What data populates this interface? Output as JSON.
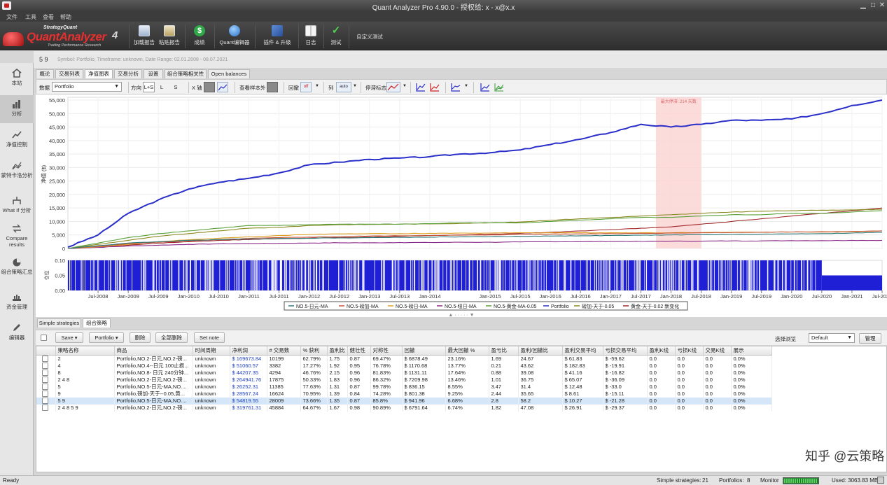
{
  "app": {
    "title": "Quant Analyzer Pro 4.90.0 - 授权给: x - x@x.x",
    "menu": [
      "文件",
      "工具",
      "查看",
      "帮助"
    ]
  },
  "logo": {
    "small_text": "StrategyQuant",
    "product_name": "QuantAnalyzer",
    "version": "4",
    "tagline": "Trading Performance Research"
  },
  "toolbar": {
    "buttons": [
      {
        "label": "加载报告",
        "icon": "load-report-icon"
      },
      {
        "label": "粘贴报告",
        "icon": "paste-report-icon"
      },
      {
        "label": "成绩",
        "icon": "dollar-icon"
      },
      {
        "label": "Quant编辑器",
        "icon": "editor-icon"
      },
      {
        "label": "插件 & 升级",
        "icon": "plugin-icon"
      },
      {
        "label": "日志",
        "icon": "log-icon"
      },
      {
        "label": "测试",
        "icon": "checkmark-icon"
      },
      {
        "label": "自定义测试",
        "icon": ""
      }
    ]
  },
  "sidebar": {
    "items": [
      {
        "label": "本站",
        "icon": "home-icon"
      },
      {
        "label": "分析",
        "icon": "analysis-icon"
      },
      {
        "label": "净值控制",
        "icon": "equity-control-icon"
      },
      {
        "label": "蒙特卡洛分析",
        "icon": "monte-carlo-icon"
      },
      {
        "label": "What If 分析",
        "icon": "whatif-icon"
      },
      {
        "label": "Compare results",
        "icon": "compare-icon"
      },
      {
        "label": "组合策略汇总",
        "icon": "pie-chart-icon"
      },
      {
        "label": "资金管理",
        "icon": "money-management-icon"
      },
      {
        "label": "编辑器",
        "icon": "pencil-icon"
      }
    ]
  },
  "strategy_header": {
    "name": "5 9",
    "info": "Symbol: Portfolio, Timeframe: unknown, Date Range: 02.01.2008 - 08.07.2021"
  },
  "tabs": [
    "概论",
    "交易列表",
    "净值图表",
    "交易分析",
    "设置",
    "组合策略相关性",
    "Open balances"
  ],
  "chart_toolbar": {
    "data_label": "数据",
    "data_value": "Portfolio",
    "direction_label": "方向",
    "direction_options": [
      "L+S",
      "L",
      "S"
    ],
    "x_axis_label": "X 轴",
    "out_of_sample_label": "查看样本外",
    "drawdown_label": "回撤",
    "drawdown_value": "off",
    "column_label": "列",
    "column_value": "auto",
    "stagnation_label": "停滞标志"
  },
  "chart_data": {
    "type": "line",
    "ylabel": "净值 ($)",
    "ylim": [
      0,
      55000
    ],
    "y_ticks": [
      "0",
      "5,000",
      "10,000",
      "15,000",
      "20,000",
      "25,000",
      "30,000",
      "35,000",
      "40,000",
      "45,000",
      "50,000",
      "55,000"
    ],
    "x_ticks": [
      "Jul-2008",
      "Jan-2009",
      "Jul-2009",
      "Jan-2010",
      "Jul-2010",
      "Jan-2011",
      "Jul-2011",
      "Jan-2012",
      "Jul-2012",
      "Jan-2013",
      "Jul-2013",
      "Jan-2014",
      "Jan-2015",
      "Jul-2015",
      "Jan-2016",
      "Jul-2016",
      "Jan-2017",
      "Jul-2017",
      "Jan-2018",
      "Jul-2018",
      "Jan-2019",
      "Jul-2019",
      "Jan-2020",
      "Jul-2020",
      "Jan-2021",
      "Jul-2021"
    ],
    "stagnation_label": "最大停滞: 214 天数",
    "stagnation_range": [
      "Oct-2017",
      "Jul-2018"
    ],
    "x": [
      "Jan-2008",
      "Jul-2008",
      "Jan-2009",
      "Jul-2009",
      "Jan-2010",
      "Jul-2010",
      "Jan-2011",
      "Jul-2011",
      "Jan-2012",
      "Jul-2012",
      "Jan-2013",
      "Jul-2013",
      "Jan-2014",
      "Jul-2014",
      "Jan-2015",
      "Jul-2015",
      "Jan-2016",
      "Jul-2016",
      "Jan-2017",
      "Jul-2017",
      "Jan-2018",
      "Jul-2018",
      "Jan-2019",
      "Jul-2019",
      "Jan-2020",
      "Jul-2020",
      "Jan-2021",
      "Jul-2021"
    ],
    "series": [
      {
        "name": "Portfolio",
        "color": "#2a2fc9",
        "values": [
          500,
          5000,
          13000,
          18000,
          22000,
          24500,
          26000,
          28000,
          31000,
          32000,
          33000,
          33500,
          34000,
          35000,
          35500,
          36500,
          38500,
          40500,
          43000,
          46000,
          45000,
          46000,
          47500,
          47500,
          48000,
          50000,
          53000,
          55000
        ]
      },
      {
        "name": "NO.5-日元-MA",
        "color": "#2d7a7a",
        "values": [
          0,
          1000,
          2000,
          2500,
          3000,
          3300,
          3500,
          3700,
          3800,
          3900,
          4000,
          4100,
          4200,
          4300,
          4400,
          4500,
          4600,
          4700,
          4800,
          4900,
          5000,
          5100,
          5200,
          5300,
          5400,
          5500,
          5700,
          6000
        ]
      },
      {
        "name": "NO.5-磅加-MA",
        "color": "#c5563c",
        "values": [
          0,
          800,
          1800,
          2300,
          2700,
          3300,
          3700,
          4000,
          4200,
          4400,
          4600,
          4700,
          4800,
          4900,
          5000,
          5200,
          5300,
          5400,
          5500,
          5600,
          5700,
          5800,
          5900,
          6000,
          6100,
          6200,
          6300,
          6500
        ]
      },
      {
        "name": "NO.5-磅日-MA",
        "color": "#e0a020",
        "values": [
          0,
          600,
          1500,
          2500,
          3200,
          3800,
          4300,
          4800,
          5200,
          5400,
          5500,
          5500,
          5600,
          5700,
          5700,
          5800,
          5800,
          5800,
          5800,
          5800,
          5800,
          5900,
          6000,
          6000,
          6100,
          6100,
          6200,
          6500
        ]
      },
      {
        "name": "NO.5-纽日-MA",
        "color": "#8a2a8a",
        "values": [
          0,
          400,
          900,
          1200,
          1500,
          1700,
          1800,
          1900,
          2000,
          2100,
          2100,
          2200,
          2200,
          2300,
          2300,
          2400,
          2500,
          2500,
          2600,
          2600,
          2700,
          2700,
          2800,
          2800,
          2900,
          2900,
          3000,
          3000
        ]
      },
      {
        "name": "NO.5-黄金-MA-0.05",
        "color": "#5aa03a",
        "values": [
          0,
          2000,
          4000,
          5500,
          6500,
          7500,
          8500,
          8500,
          8800,
          9000,
          9000,
          9000,
          9200,
          9500,
          9500,
          9500,
          10000,
          10500,
          11000,
          11500,
          11500,
          12000,
          12500,
          12500,
          13000,
          13000,
          13500,
          14000
        ]
      },
      {
        "name": "磅加-天于-0.05",
        "color": "#8a8a22",
        "values": [
          0,
          1500,
          3000,
          4500,
          5500,
          6500,
          7500,
          7800,
          8500,
          8800,
          8900,
          9000,
          9100,
          9300,
          9500,
          9800,
          10500,
          11000,
          11500,
          12000,
          12500,
          13000,
          13500,
          13800,
          14000,
          14200,
          14300,
          14500
        ]
      },
      {
        "name": "黄金-天于-0.02 新变化",
        "color": "#a0282a",
        "values": [
          0,
          500,
          1200,
          2000,
          2500,
          3000,
          3300,
          3600,
          3800,
          4000,
          4200,
          4500,
          4800,
          5000,
          5300,
          5600,
          6000,
          6500,
          7000,
          7500,
          8000,
          9000,
          10000,
          11000,
          12000,
          13000,
          14000,
          15000
        ]
      }
    ],
    "positions_ylim": [
      0.0,
      0.1
    ],
    "positions_ylabel": "仓位",
    "positions_y_ticks": [
      "0.00",
      "0.05",
      "0.10"
    ]
  },
  "bottom": {
    "tabs": [
      "Simple strategies",
      "组合策略"
    ],
    "buttons": [
      "Save",
      "Portfolio",
      "删除",
      "全部删除",
      "Set note"
    ],
    "view_label": "选择浏览",
    "view_value": "Default",
    "manage_label": "管理",
    "columns": [
      "策略名称",
      "商品",
      "时间周期",
      "净利润",
      "# 交易数",
      "% 获利",
      "盈利比",
      "健壮性",
      "对称性",
      "回撤",
      "最大回撤 %",
      "盈亏比",
      "盈利/回撤比",
      "盈利交易平均",
      "亏损交易平均",
      "盈利K线",
      "亏损K线",
      "交易K线",
      "展示"
    ],
    "rows": [
      [
        "2",
        "Portfolio,NO.2-日元,NO.2-磅...",
        "unknown",
        "$ 169673.84",
        "10199",
        "62.79%",
        "1.75",
        "0.87",
        "69.47%",
        "$ 6878.49",
        "23.16%",
        "1.69",
        "24.67",
        "$ 61.83",
        "$ -59.62",
        "0.0",
        "0.0",
        "0.0",
        "0.0%"
      ],
      [
        "4",
        "Portfolio,NO.4--日元 100止损...",
        "unknown",
        "$ 51060.57",
        "3382",
        "17.27%",
        "1.92",
        "0.95",
        "76.78%",
        "$ 1170.68",
        "13.77%",
        "0.21",
        "43.62",
        "$ 182.83",
        "$ -19.91",
        "0.0",
        "0.0",
        "0.0",
        "0.0%"
      ],
      [
        "8",
        "Portfolio,NO.8- 日元 240分钟...",
        "unknown",
        "$ 44207.35",
        "4294",
        "46.76%",
        "2.15",
        "0.96",
        "81.83%",
        "$ 1131.11",
        "17.64%",
        "0.88",
        "39.08",
        "$ 41.16",
        "$ -16.82",
        "0.0",
        "0.0",
        "0.0",
        "0.0%"
      ],
      [
        "2 4 8",
        "Portfolio,NO.2-日元,NO.2-磅...",
        "unknown",
        "$ 264941.76",
        "17875",
        "50.33%",
        "1.83",
        "0.96",
        "86.32%",
        "$ 7209.98",
        "13.46%",
        "1.01",
        "36.75",
        "$ 65.07",
        "$ -36.09",
        "0.0",
        "0.0",
        "0.0",
        "0.0%"
      ],
      [
        "5",
        "Portfolio,NO.5-日元-MA,NO....",
        "unknown",
        "$ 26252.31",
        "11385",
        "77.63%",
        "1.31",
        "0.87",
        "99.78%",
        "$ 836.15",
        "8.55%",
        "3.47",
        "31.4",
        "$ 12.48",
        "$ -33.0",
        "0.0",
        "0.0",
        "0.0",
        "0.0%"
      ],
      [
        "9",
        "Portfolio,磅加-天于--0.05,黄...",
        "unknown",
        "$ 28567.24",
        "16624",
        "70.95%",
        "1.39",
        "0.84",
        "74.28%",
        "$ 801.38",
        "9.25%",
        "2.44",
        "35.65",
        "$ 8.61",
        "$ -15.11",
        "0.0",
        "0.0",
        "0.0",
        "0.0%"
      ],
      [
        "5 9",
        "Portfolio,NO.5-日元-MA,NO....",
        "unknown",
        "$ 54819.55",
        "28009",
        "73.66%",
        "1.35",
        "0.87",
        "85.8%",
        "$ 941.96",
        "6.68%",
        "2.8",
        "58.2",
        "$ 10.27",
        "$ -21.28",
        "0.0",
        "0.0",
        "0.0",
        "0.0%"
      ],
      [
        "2 4 8 5 9",
        "Portfolio,NO.2-日元,NO.2-磅...",
        "unknown",
        "$ 319761.31",
        "45884",
        "64.67%",
        "1.67",
        "0.98",
        "90.89%",
        "$ 6791.64",
        "6.74%",
        "1.82",
        "47.08",
        "$ 26.91",
        "$ -29.37",
        "0.0",
        "0.0",
        "0.0",
        "0.0%"
      ]
    ],
    "selected_row": 6
  },
  "statusbar": {
    "ready": "Ready",
    "simple_strategies_label": "Simple strategies:",
    "simple_strategies_value": "21",
    "portfolios_label": "Portfolios:",
    "portfolios_value": "8",
    "monitor_label": "Monitor",
    "used_label": "Used: 3063.83 MB"
  },
  "watermark": "知乎 @云策略"
}
